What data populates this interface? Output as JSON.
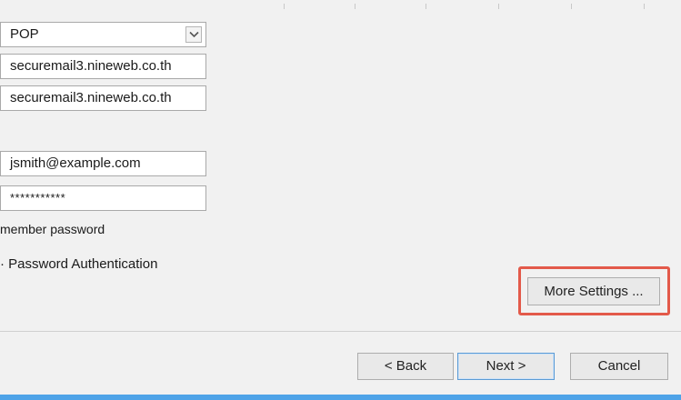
{
  "account": {
    "type_value": "POP",
    "incoming_server": "securemail3.nineweb.co.th",
    "outgoing_server": "securemail3.nineweb.co.th",
    "user_name": "jsmith@example.com",
    "password_masked": "***********"
  },
  "options": {
    "remember_password_label": "member password",
    "spa_label": "· Password Authentication"
  },
  "buttons": {
    "more_settings": "More Settings ...",
    "back": "< Back",
    "next": "Next >",
    "cancel": "Cancel"
  },
  "icons": {
    "dropdown": "chevron-down-icon"
  },
  "colors": {
    "highlight": "#e35a4a",
    "accent": "#4ea3e8",
    "default_button_border": "#5b9bd5"
  }
}
